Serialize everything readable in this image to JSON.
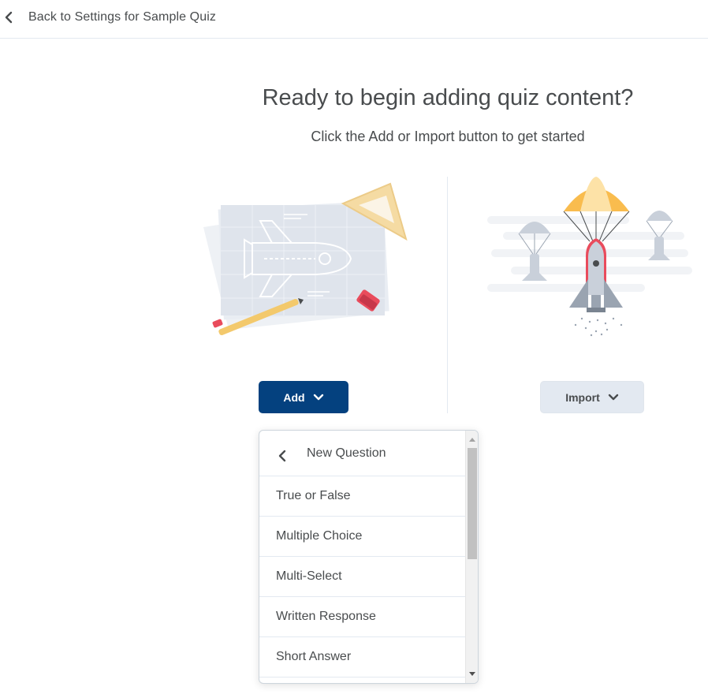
{
  "nav": {
    "back_label": "Back to Settings for Sample Quiz"
  },
  "hero": {
    "title": "Ready to begin adding quiz content?",
    "subtitle": "Click the Add or Import button to get started"
  },
  "actions": {
    "add_label": "Add",
    "import_label": "Import"
  },
  "menu": {
    "header_label": "New Question",
    "items": [
      "True or False",
      "Multiple Choice",
      "Multi-Select",
      "Written Response",
      "Short Answer"
    ]
  },
  "icons": {
    "back": "chevron-left-icon",
    "dropdown": "chevron-down-icon",
    "menu_back": "chevron-left-icon"
  },
  "colors": {
    "primary": "#04417f",
    "secondary_bg": "#e3e9f1",
    "text": "#494c4e",
    "parachute": "#f9bc4e",
    "eraser": "#e94b5c"
  }
}
